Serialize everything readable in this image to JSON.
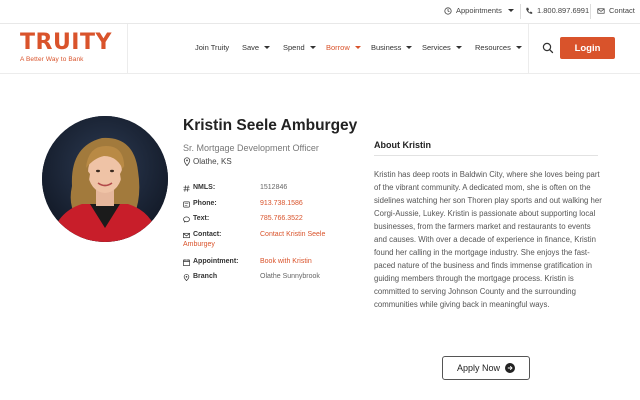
{
  "topbar": {
    "appointments_label": "Appointments",
    "phone": "1.800.897.6991",
    "contact_label": "Contact"
  },
  "header": {
    "logo_text": "TRUITY",
    "tagline": "A Better Way to Bank",
    "nav": [
      {
        "label": "Join Truity"
      },
      {
        "label": "Save"
      },
      {
        "label": "Spend"
      },
      {
        "label": "Borrow"
      },
      {
        "label": "Business"
      },
      {
        "label": "Services"
      },
      {
        "label": "Resources"
      }
    ],
    "login_label": "Login",
    "accent_color": "#d9532b"
  },
  "profile": {
    "name": "Kristin Seele Amburgey",
    "title": "Sr. Mortgage Development Officer",
    "location": "Olathe, KS",
    "details": {
      "nmls_label": "NMLS:",
      "nmls_value": "1512846",
      "phone_label": "Phone:",
      "phone_value": "913.738.1586",
      "text_label": "Text:",
      "text_value": "785.766.3522",
      "contact_label": "Contact:",
      "contact_value_1": "Contact Kristin Seele",
      "contact_value_2": "Amburgey",
      "appointment_label": "Appointment:",
      "appointment_value": "Book with Kristin",
      "branch_label": "Branch",
      "branch_value": "Olathe Sunnybrook"
    }
  },
  "about": {
    "heading": "About Kristin",
    "body": "Kristin has deep roots in Baldwin City, where she loves being part of the vibrant community. A dedicated mom, she is often on the sidelines watching her son Thoren play sports and out walking her Corgi-Aussie, Lukey. Kristin is passionate about supporting local businesses, from the farmers market and restaurants to events and causes. With over a decade of experience in finance, Kristin found her calling in the mortgage industry. She enjoys the fast-paced nature of the business and finds immense gratification in guiding members through the mortgage process. Kristin is committed to serving Johnson County and the surrounding communities while giving back in meaningful ways.",
    "apply_label": "Apply Now"
  }
}
